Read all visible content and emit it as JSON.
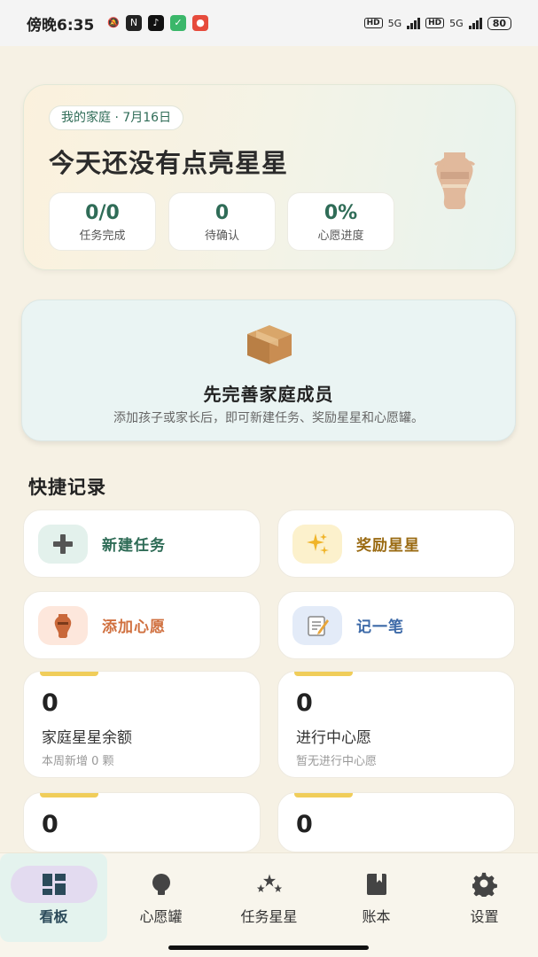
{
  "status_bar": {
    "time": "傍晚6:35",
    "network": "5G",
    "hd": "HD",
    "battery": "80"
  },
  "hero": {
    "badge": "我的家庭 · 7月16日",
    "title": "今天还没有点亮星星",
    "stats": [
      {
        "value": "0/0",
        "label": "任务完成"
      },
      {
        "value": "0",
        "label": "待确认"
      },
      {
        "value": "0%",
        "label": "心愿进度"
      }
    ]
  },
  "onboarding": {
    "title": "先完善家庭成员",
    "description": "添加孩子或家长后，即可新建任务、奖励星星和心愿罐。"
  },
  "quick": {
    "title": "快捷记录",
    "actions": [
      {
        "label": "新建任务",
        "icon": "plus-icon",
        "icon_glyph": "➕",
        "color": "#2f6c57",
        "bg": "#e3f1ec"
      },
      {
        "label": "奖励星星",
        "icon": "sparkles-icon",
        "icon_glyph": "✨",
        "color": "#9a6a12",
        "bg": "#fcf1cc"
      },
      {
        "label": "添加心愿",
        "icon": "vase-icon",
        "icon_glyph": "🏺",
        "color": "#d0703f",
        "bg": "#fde7dc"
      },
      {
        "label": "记一笔",
        "icon": "memo-icon",
        "icon_glyph": "📝",
        "color": "#3d6aa8",
        "bg": "#e3ebf8"
      }
    ]
  },
  "summary": [
    {
      "value": "0",
      "name": "家庭星星余额",
      "sub": "本周新增 0 颗"
    },
    {
      "value": "0",
      "name": "进行中心愿",
      "sub": "暂无进行中心愿"
    },
    {
      "value": "0",
      "name": "",
      "sub": ""
    },
    {
      "value": "0",
      "name": "",
      "sub": ""
    }
  ],
  "nav": [
    {
      "label": "看板",
      "icon": "dashboard-icon",
      "active": true
    },
    {
      "label": "心愿罐",
      "icon": "wish-jar-icon",
      "active": false
    },
    {
      "label": "任务星星",
      "icon": "stars-icon",
      "active": false
    },
    {
      "label": "账本",
      "icon": "ledger-icon",
      "active": false
    },
    {
      "label": "设置",
      "icon": "gear-icon",
      "active": false
    }
  ],
  "colors": {
    "background": "#f6f1e4",
    "accent": "#2f6c57",
    "highlight": "#f0cd5a"
  }
}
